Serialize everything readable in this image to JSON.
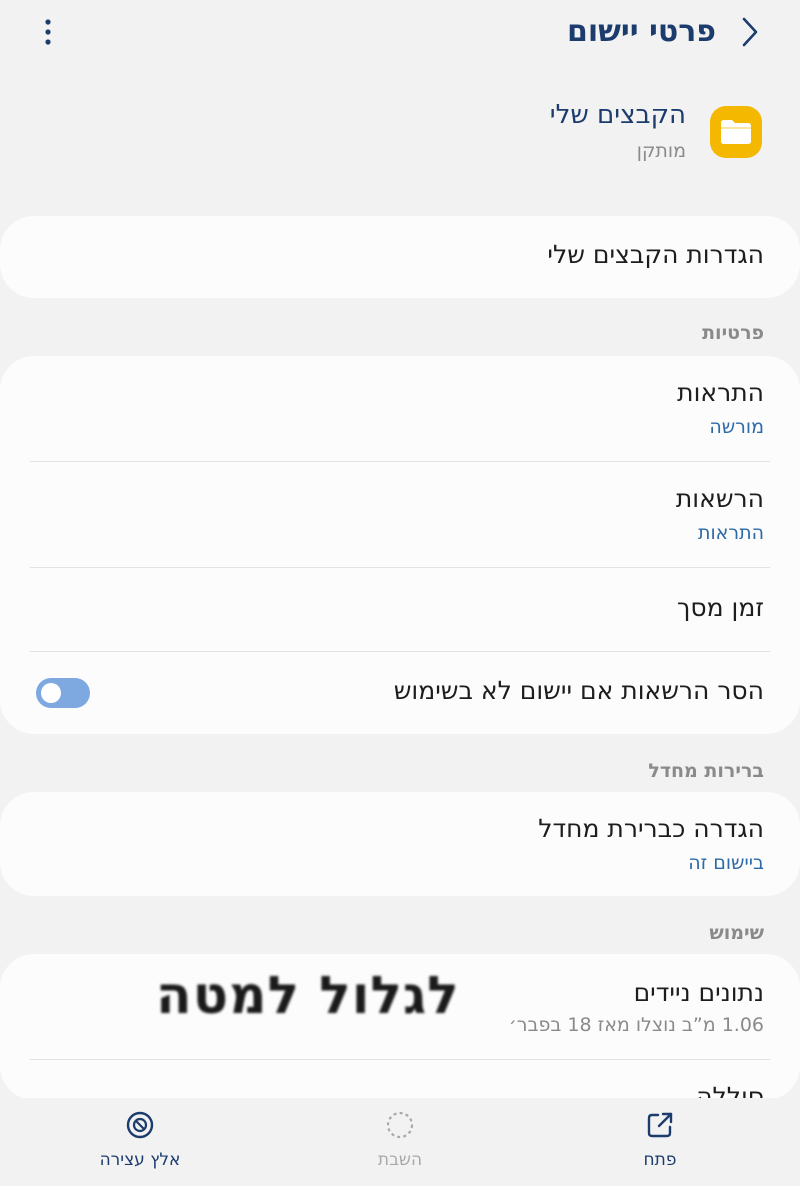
{
  "header": {
    "title": "פרטי יישום",
    "back_icon": "chevron-right-icon",
    "more_icon": "more-vertical-icon"
  },
  "app": {
    "name": "הקבצים שלי",
    "status": "מותקן",
    "icon": "folder-icon",
    "icon_color": "#f5b800"
  },
  "settings_card": {
    "label": "הגדרות הקבצים שלי"
  },
  "privacy": {
    "section_label": "פרטיות",
    "notifications": {
      "title": "התראות",
      "subtitle": "מורשה"
    },
    "permissions": {
      "title": "הרשאות",
      "subtitle": "התראות"
    },
    "screen_time": {
      "title": "זמן מסך"
    },
    "remove_permissions": {
      "title": "הסר הרשאות אם יישום לא בשימוש",
      "enabled": true
    }
  },
  "defaults": {
    "section_label": "ברירות מחדל",
    "set_default": {
      "title": "הגדרה כברירת מחדל",
      "subtitle": "ביישום זה"
    }
  },
  "usage": {
    "section_label": "שימוש",
    "mobile_data": {
      "title": "נתונים ניידים",
      "subtitle": "1.06 מ”ב נוצלו מאז 18 בפבר׳"
    },
    "battery": {
      "title": "סוללה"
    }
  },
  "overlay": {
    "text": "לגלול למטה"
  },
  "bottom_bar": {
    "open": {
      "label": "פתח",
      "icon": "open-external-icon"
    },
    "disable": {
      "label": "השבת",
      "icon": "disable-icon"
    },
    "force_stop": {
      "label": "אלץ עצירה",
      "icon": "force-stop-icon"
    }
  },
  "colors": {
    "accent": "#1c3c6e",
    "link": "#2c6aa8",
    "toggle_on": "#7ea9e0",
    "background": "#f2f2f2",
    "card": "#fcfcfc"
  }
}
